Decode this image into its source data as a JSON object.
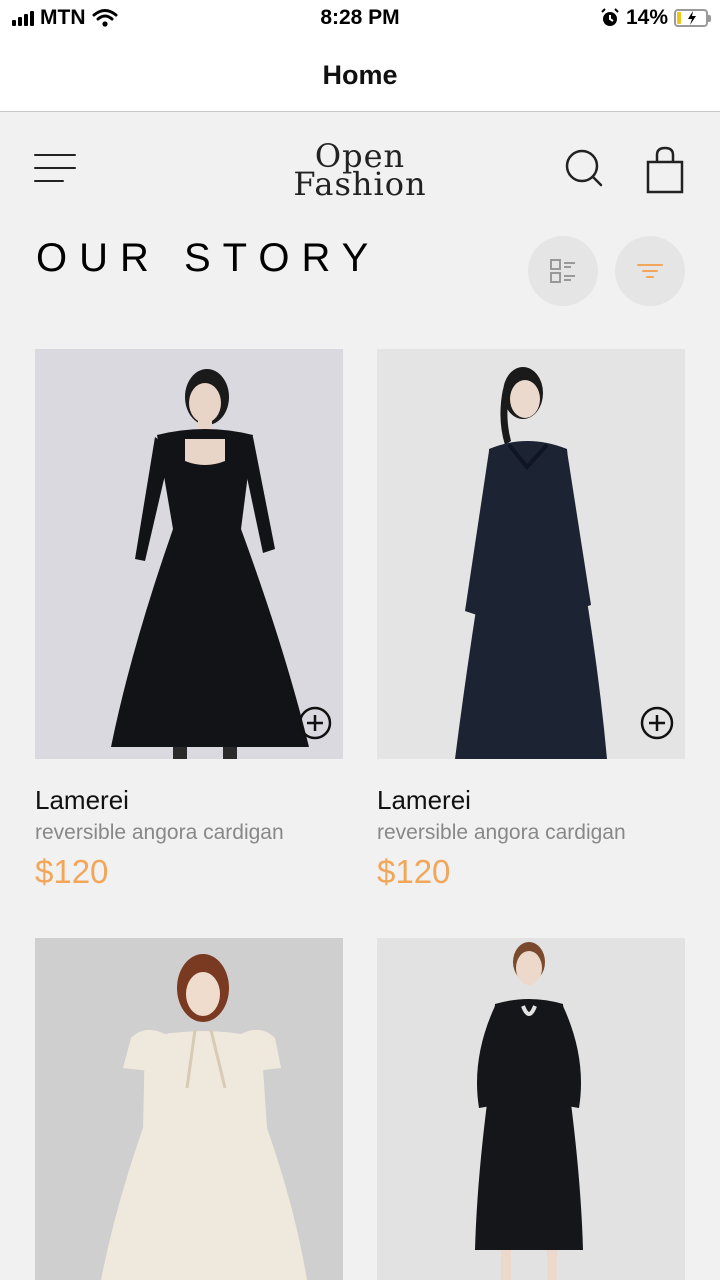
{
  "status_bar": {
    "carrier": "MTN",
    "time": "8:28 PM",
    "battery_percent": "14%",
    "battery_level": 0.14
  },
  "nav": {
    "title": "Home"
  },
  "header": {
    "logo_line1": "Open",
    "logo_line2": "Fashion"
  },
  "section": {
    "title": "OUR STORY"
  },
  "colors": {
    "accent": "#f2a65a",
    "background": "#f1f1f1",
    "text_secondary": "#888888"
  },
  "products": [
    {
      "brand": "Lamerei",
      "description": "reversible angora cardigan",
      "price": "$120",
      "dress_color": "#121316",
      "photo_bg": "#d9d9df"
    },
    {
      "brand": "Lamerei",
      "description": "reversible angora cardigan",
      "price": "$120",
      "dress_color": "#1c2333",
      "photo_bg": "#e4e4e4"
    },
    {
      "brand": "",
      "description": "",
      "price": "",
      "dress_color": "#efe8dc",
      "photo_bg": "#cfcfcf"
    },
    {
      "brand": "",
      "description": "",
      "price": "",
      "dress_color": "#15161a",
      "photo_bg": "#e2e2e2"
    }
  ]
}
